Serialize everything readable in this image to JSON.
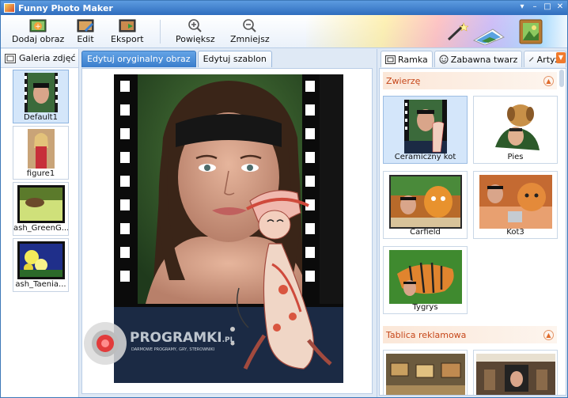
{
  "window": {
    "title": "Funny Photo Maker",
    "controls": [
      "▾",
      "–",
      "□",
      "✕"
    ]
  },
  "toolbar": {
    "buttons": [
      {
        "label": "Dodaj obraz",
        "icon": "add-image-icon"
      },
      {
        "label": "Edit",
        "icon": "edit-icon"
      },
      {
        "label": "Eksport",
        "icon": "export-icon"
      },
      {
        "label": "Powiększ",
        "icon": "zoom-in-icon"
      },
      {
        "label": "Zmniejsz",
        "icon": "zoom-out-icon"
      }
    ]
  },
  "gallery": {
    "title": "Galeria zdjęć",
    "items": [
      {
        "caption": "Default1",
        "selected": true
      },
      {
        "caption": "figure1",
        "selected": false
      },
      {
        "caption": "ash_GreenG...",
        "selected": false
      },
      {
        "caption": "ash_Taenia...",
        "selected": false
      }
    ]
  },
  "editor": {
    "tabs": [
      {
        "label": "Edytuj oryginalny obraz",
        "active": true
      },
      {
        "label": "Edytuj szablon",
        "active": false
      }
    ],
    "watermark": {
      "brand": "PROGRAMKI",
      "suffix": ".PL",
      "tagline": "DARMOWE PROGRAMY, GRY, STEROWNIKI"
    }
  },
  "templates": {
    "tabs": [
      {
        "label": "Ramka",
        "icon": "frame-icon",
        "active": true
      },
      {
        "label": "Zabawna twarz",
        "icon": "smiley-icon",
        "active": false
      },
      {
        "label": "Artyzi",
        "icon": "brush-icon",
        "active": false
      }
    ],
    "sections": [
      {
        "title": "Zwierzę",
        "items": [
          {
            "caption": "Ceramiczny kot",
            "selected": true
          },
          {
            "caption": "Pies",
            "selected": false
          },
          {
            "caption": "Carfield",
            "selected": false
          },
          {
            "caption": "Kot3",
            "selected": false
          },
          {
            "caption": "Tygrys",
            "selected": false
          }
        ]
      },
      {
        "title": "Tablica reklamowa",
        "items": [
          {
            "caption": "",
            "selected": false
          },
          {
            "caption": "",
            "selected": false
          }
        ]
      }
    ]
  },
  "colors": {
    "titlebar": "#2f6dbd",
    "active_tab": "#3a7dcc",
    "section_text": "#c6471a",
    "selection": "#d4e6fa"
  }
}
